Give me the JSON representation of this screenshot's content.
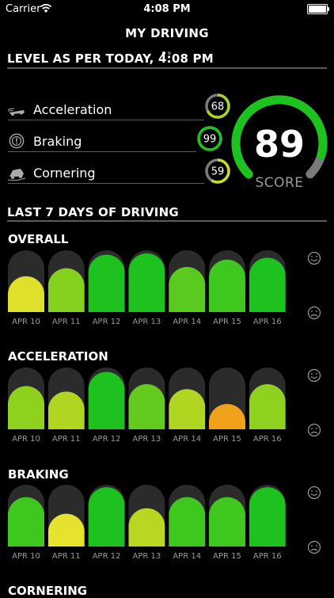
{
  "status_bar": {
    "carrier": "Carrier",
    "time": "4:08 PM"
  },
  "nav": {
    "title": "MY DRIVING",
    "page_count": 2,
    "active_page": 1
  },
  "level_section": {
    "header": "LEVEL AS PER TODAY, 4:08 PM"
  },
  "metrics": [
    {
      "label": "Acceleration",
      "value": 68,
      "color": "#a8d32a",
      "icon": "car-acceleration-icon"
    },
    {
      "label": "Braking",
      "value": 99,
      "color": "#1ec21e",
      "icon": "braking-icon"
    },
    {
      "label": "Cornering",
      "value": 59,
      "color": "#c9dd28",
      "icon": "car-cornering-icon"
    }
  ],
  "score": {
    "value": "89",
    "label": "SCORE",
    "fraction": 0.89,
    "color": "#1ec21e",
    "track_color": "#7a7a7a"
  },
  "week_section": {
    "header": "LAST 7 DAYS OF DRIVING"
  },
  "charts": [
    {
      "title": "OVERALL",
      "dates": [
        "APR 10",
        "APR 11",
        "APR 12",
        "APR 13",
        "APR 14",
        "APR 15",
        "APR 16"
      ],
      "levels": [
        0.58,
        0.71,
        0.93,
        0.95,
        0.73,
        0.85,
        0.88
      ],
      "colors": [
        "#dee02a",
        "#84d21e",
        "#1ec21e",
        "#1ec21e",
        "#5acb1e",
        "#3ec71e",
        "#1ec21e"
      ]
    },
    {
      "title": "ACCELERATION",
      "dates": [
        "APR 10",
        "APR 11",
        "APR 12",
        "APR 13",
        "APR 14",
        "APR 15",
        "APR 16"
      ],
      "levels": [
        0.7,
        0.61,
        0.93,
        0.73,
        0.65,
        0.41,
        0.73
      ],
      "colors": [
        "#8ed11e",
        "#b1d622",
        "#1ec21e",
        "#62cb1e",
        "#b1d622",
        "#f0a21a",
        "#8ed11e"
      ]
    },
    {
      "title": "BRAKING",
      "dates": [
        "APR 10",
        "APR 11",
        "APR 12",
        "APR 13",
        "APR 14",
        "APR 15",
        "APR 16"
      ],
      "levels": [
        0.8,
        0.53,
        0.96,
        0.62,
        0.8,
        0.8,
        0.96
      ],
      "colors": [
        "#3ec71e",
        "#e6e32e",
        "#1ec21e",
        "#b8d622",
        "#3ec71e",
        "#3ec71e",
        "#1ec21e"
      ]
    }
  ],
  "next_section": {
    "title": "CORNERING"
  },
  "colors": {
    "bar_track": "#2b2b2b",
    "divider": "#5c5c5c"
  }
}
